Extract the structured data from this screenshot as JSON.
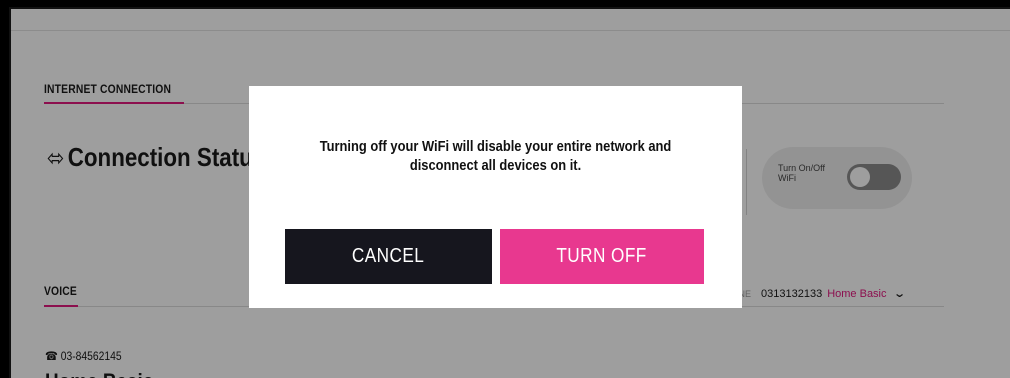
{
  "internet": {
    "section_title": "INTERNET CONNECTION",
    "connection_status_title": "Connection Status",
    "link_icon": "link-icon",
    "wifi_toggle_label": "Turn On/Off WiFi",
    "wifi_toggle_state": "on"
  },
  "voice": {
    "section_title": "VOICE",
    "line_label": "LINE",
    "line_number": "0313132133",
    "plan_name": "Home Basic",
    "chevron_icon": "chevron-down-icon",
    "phone_number": "03-84562145",
    "phone_icon": "phone-icon",
    "plan_bottom": "Home Basic"
  },
  "modal": {
    "message": "Turning off your WiFi will disable your entire network and disconnect all devices on it.",
    "cancel_label": "CANCEL",
    "turn_off_label": "TURN OFF"
  },
  "colors": {
    "accent_pink": "#e2197f",
    "turn_off_button": "#e8388f",
    "cancel_button": "#16161e"
  }
}
